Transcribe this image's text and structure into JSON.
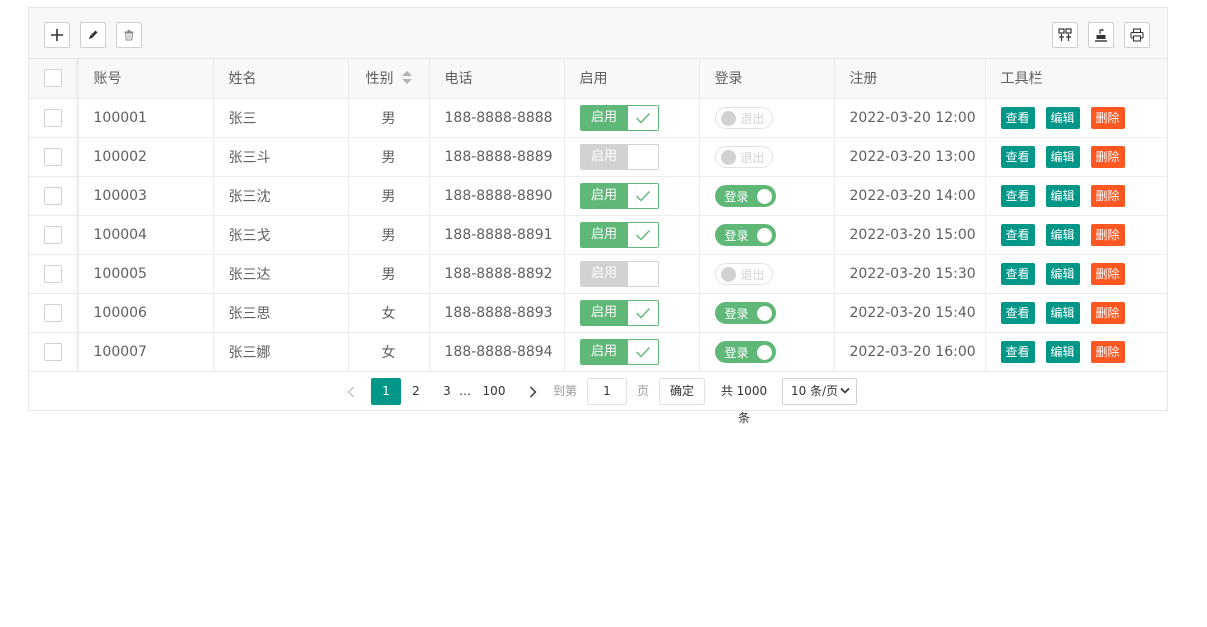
{
  "toolbar": {
    "left_icons": [
      "plus-icon",
      "pencil-icon",
      "trash-icon"
    ],
    "right_icons": [
      "columns-icon",
      "export-icon",
      "print-icon"
    ]
  },
  "columns": {
    "account": "账号",
    "name": "姓名",
    "sex": "性别",
    "phone": "电话",
    "enabled": "启用",
    "login": "登录",
    "register": "注册",
    "tools": "工具栏"
  },
  "rows": [
    {
      "account": "100001",
      "name": "张三",
      "sex": "男",
      "phone": "188-8888-8888",
      "enabled": true,
      "login": false,
      "register": "2022-03-20 12:00"
    },
    {
      "account": "100002",
      "name": "张三斗",
      "sex": "男",
      "phone": "188-8888-8889",
      "enabled": false,
      "login": false,
      "register": "2022-03-20 13:00"
    },
    {
      "account": "100003",
      "name": "张三沈",
      "sex": "男",
      "phone": "188-8888-8890",
      "enabled": true,
      "login": true,
      "register": "2022-03-20 14:00"
    },
    {
      "account": "100004",
      "name": "张三戈",
      "sex": "男",
      "phone": "188-8888-8891",
      "enabled": true,
      "login": true,
      "register": "2022-03-20 15:00"
    },
    {
      "account": "100005",
      "name": "张三达",
      "sex": "男",
      "phone": "188-8888-8892",
      "enabled": false,
      "login": false,
      "register": "2022-03-20 15:30"
    },
    {
      "account": "100006",
      "name": "张三思",
      "sex": "女",
      "phone": "188-8888-8893",
      "enabled": true,
      "login": true,
      "register": "2022-03-20 15:40"
    },
    {
      "account": "100007",
      "name": "张三娜",
      "sex": "女",
      "phone": "188-8888-8894",
      "enabled": true,
      "login": true,
      "register": "2022-03-20 16:00"
    }
  ],
  "labels": {
    "enabled_text": "启用",
    "login_on": "登录",
    "login_off": "退出",
    "view": "查看",
    "edit": "编辑",
    "delete": "删除"
  },
  "colors": {
    "primary": "#009688",
    "danger": "#FF5722",
    "enabled_on": "#5FB878",
    "enabled_off": "#d2d2d2"
  },
  "pagination": {
    "current": "1",
    "page2": "2",
    "page3": "3",
    "ellipsis": "…",
    "last": "100",
    "goto_label": "到第",
    "goto_value": "1",
    "page_unit": "页",
    "confirm": "确定",
    "total": "共 1000 条",
    "page_size": "10 条/页"
  }
}
